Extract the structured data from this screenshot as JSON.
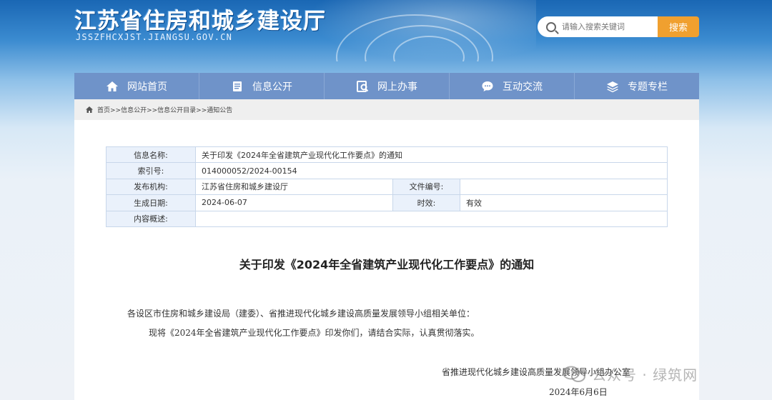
{
  "header": {
    "site_title": "江苏省住房和城乡建设厅",
    "site_domain": "JSSZFHCXJST.JIANGSU.GOV.CN",
    "search_placeholder": "请输入搜索关键词",
    "search_button": "搜索"
  },
  "nav": {
    "items": [
      {
        "label": "网站首页",
        "icon": "home-icon"
      },
      {
        "label": "信息公开",
        "icon": "document-icon"
      },
      {
        "label": "网上办事",
        "icon": "service-icon"
      },
      {
        "label": "互动交流",
        "icon": "chat-icon"
      },
      {
        "label": "专题专栏",
        "icon": "layers-icon"
      }
    ]
  },
  "breadcrumb": "首页>>信息公开>>信息公开目录>>通知公告",
  "info": {
    "name_label": "信息名称:",
    "name_value": "关于印发《2024年全省建筑产业现代化工作要点》的通知",
    "index_label": "索引号:",
    "index_value": "014000052/2024-00154",
    "org_label": "发布机构:",
    "org_value": "江苏省住房和城乡建设厅",
    "docno_label": "文件编号:",
    "docno_value": "",
    "date_label": "生成日期:",
    "date_value": "2024-06-07",
    "validity_label": "时效:",
    "validity_value": "有效",
    "summary_label": "内容概述:",
    "summary_value": ""
  },
  "document": {
    "title": "关于印发《2024年全省建筑产业现代化工作要点》的通知",
    "salutation": "各设区市住房和城乡建设局（建委）、省推进现代化城乡建设高质量发展领导小组相关单位：",
    "body": "现将《2024年全省建筑产业现代化工作要点》印发你们，请结合实际，认真贯彻落实。",
    "signature": "省推进现代化城乡建设高质量发展领导小组办公室",
    "date": "2024年6月6日"
  },
  "watermark": "公众号 · 绿筑网",
  "colors": {
    "nav_bg": "#6f93c9",
    "search_btn": "#f0a02f",
    "table_key_bg": "#eaf1fb"
  }
}
